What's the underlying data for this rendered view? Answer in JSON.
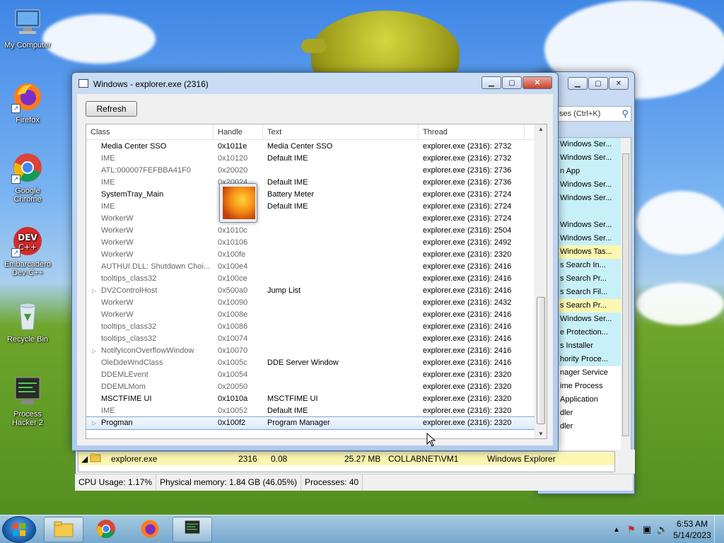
{
  "desktop": {
    "icons": [
      {
        "label": "My Computer"
      },
      {
        "label": "Firefox"
      },
      {
        "label": "Google Chrome"
      },
      {
        "label": "Embarcadero Dev-C++"
      },
      {
        "label": "Recycle Bin"
      },
      {
        "label": "Process Hacker 2"
      }
    ]
  },
  "back_window": {
    "search_placeholder": "ses (Ctrl+K)",
    "service_items": [
      {
        "text": "Windows Ser...",
        "hl": "cyan"
      },
      {
        "text": "Windows Ser...",
        "hl": "cyan"
      },
      {
        "text": "n App",
        "hl": "cyan"
      },
      {
        "text": "Windows Ser...",
        "hl": "cyan"
      },
      {
        "text": "Windows Ser...",
        "hl": "cyan"
      },
      {
        "text": "",
        "hl": "cyan"
      },
      {
        "text": "Windows Ser...",
        "hl": "cyan"
      },
      {
        "text": "Windows Ser...",
        "hl": "cyan"
      },
      {
        "text": "Windows Tas...",
        "hl": "yellow"
      },
      {
        "text": "s Search In...",
        "hl": "cyan"
      },
      {
        "text": "s Search Pr...",
        "hl": "cyan"
      },
      {
        "text": "s Search Fil...",
        "hl": "cyan"
      },
      {
        "text": "s Search Pr...",
        "hl": "yellow"
      },
      {
        "text": "Windows Ser...",
        "hl": "cyan"
      },
      {
        "text": "e Protection...",
        "hl": "cyan"
      },
      {
        "text": "s Installer",
        "hl": "cyan"
      },
      {
        "text": "hority Proce...",
        "hl": "cyan"
      },
      {
        "text": "nager Service",
        "hl": ""
      },
      {
        "text": "ime Process",
        "hl": ""
      },
      {
        "text": "Application",
        "hl": ""
      },
      {
        "text": "dler",
        "hl": ""
      },
      {
        "text": "dler",
        "hl": ""
      }
    ],
    "process_row": {
      "name": "explorer.exe",
      "pid": "2316",
      "cpu": "0.08",
      "memory": "25.27 MB",
      "user": "COLLABNET\\VM1",
      "description": "Windows Explorer"
    }
  },
  "dialog": {
    "title": "Windows - explorer.exe (2316)",
    "refresh_label": "Refresh",
    "columns": [
      "Class",
      "Handle",
      "Text",
      "Thread"
    ],
    "rows": [
      {
        "exp": "",
        "cls": "Media Center SSO",
        "handle": "0x1011e",
        "text": "Media Center SSO",
        "thread": "explorer.exe (2316): 2732",
        "grey": false
      },
      {
        "exp": "",
        "cls": "IME",
        "handle": "0x10120",
        "text": "Default IME",
        "thread": "explorer.exe (2316): 2732",
        "grey": true
      },
      {
        "exp": "",
        "cls": "ATL:000007FEFBBA41F0",
        "handle": "0x20020",
        "text": "",
        "thread": "explorer.exe (2316): 2736",
        "grey": true
      },
      {
        "exp": "",
        "cls": "IME",
        "handle": "0x20024",
        "text": "Default IME",
        "thread": "explorer.exe (2316): 2736",
        "grey": true
      },
      {
        "exp": "",
        "cls": "SystemTray_Main",
        "handle": "",
        "text": "Battery Meter",
        "thread": "explorer.exe (2316): 2724",
        "grey": false
      },
      {
        "exp": "",
        "cls": "IME",
        "handle": "",
        "text": "Default IME",
        "thread": "explorer.exe (2316): 2724",
        "grey": true
      },
      {
        "exp": "",
        "cls": "WorkerW",
        "handle": "",
        "text": "",
        "thread": "explorer.exe (2316): 2724",
        "grey": true
      },
      {
        "exp": "",
        "cls": "WorkerW",
        "handle": "0x1010c",
        "text": "",
        "thread": "explorer.exe (2316): 2504",
        "grey": true
      },
      {
        "exp": "",
        "cls": "WorkerW",
        "handle": "0x10106",
        "text": "",
        "thread": "explorer.exe (2316): 2492",
        "grey": true
      },
      {
        "exp": "",
        "cls": "WorkerW",
        "handle": "0x100fe",
        "text": "",
        "thread": "explorer.exe (2316): 2320",
        "grey": true
      },
      {
        "exp": "",
        "cls": "AUTHUI.DLL: Shutdown Choi...",
        "handle": "0x100e4",
        "text": "",
        "thread": "explorer.exe (2316): 2416",
        "grey": true
      },
      {
        "exp": "",
        "cls": "tooltips_class32",
        "handle": "0x100ce",
        "text": "",
        "thread": "explorer.exe (2316): 2416",
        "grey": true
      },
      {
        "exp": "▷",
        "cls": "DV2ControlHost",
        "handle": "0x500a0",
        "text": "Jump List",
        "thread": "explorer.exe (2316): 2416",
        "grey": true
      },
      {
        "exp": "",
        "cls": "WorkerW",
        "handle": "0x10090",
        "text": "",
        "thread": "explorer.exe (2316): 2432",
        "grey": true
      },
      {
        "exp": "",
        "cls": "WorkerW",
        "handle": "0x1008e",
        "text": "",
        "thread": "explorer.exe (2316): 2416",
        "grey": true
      },
      {
        "exp": "",
        "cls": "tooltips_class32",
        "handle": "0x10086",
        "text": "",
        "thread": "explorer.exe (2316): 2416",
        "grey": true
      },
      {
        "exp": "",
        "cls": "tooltips_class32",
        "handle": "0x10074",
        "text": "",
        "thread": "explorer.exe (2316): 2416",
        "grey": true
      },
      {
        "exp": "▷",
        "cls": "NotifyIconOverflowWindow",
        "handle": "0x10070",
        "text": "",
        "thread": "explorer.exe (2316): 2416",
        "grey": true
      },
      {
        "exp": "",
        "cls": "OleDdeWndClass",
        "handle": "0x1005c",
        "text": "DDE Server Window",
        "thread": "explorer.exe (2316): 2416",
        "grey": true
      },
      {
        "exp": "",
        "cls": "DDEMLEvent",
        "handle": "0x10054",
        "text": "",
        "thread": "explorer.exe (2316): 2320",
        "grey": true
      },
      {
        "exp": "",
        "cls": "DDEMLMom",
        "handle": "0x20050",
        "text": "",
        "thread": "explorer.exe (2316): 2320",
        "grey": true
      },
      {
        "exp": "",
        "cls": "MSCTFIME UI",
        "handle": "0x1010a",
        "text": "MSCTFIME UI",
        "thread": "explorer.exe (2316): 2320",
        "grey": false
      },
      {
        "exp": "",
        "cls": "IME",
        "handle": "0x10052",
        "text": "Default IME",
        "thread": "explorer.exe (2316): 2320",
        "grey": true
      },
      {
        "exp": "▷",
        "cls": "Progman",
        "handle": "0x100f2",
        "text": "Program Manager",
        "thread": "explorer.exe (2316): 2320",
        "grey": false,
        "selected": true
      }
    ]
  },
  "statusbar": {
    "cpu": "CPU Usage: 1.17%",
    "memory": "Physical memory: 1.84 GB (46.05%)",
    "processes": "Processes: 40"
  },
  "taskbar": {
    "time": "6:53 AM",
    "date": "5/14/2023"
  }
}
